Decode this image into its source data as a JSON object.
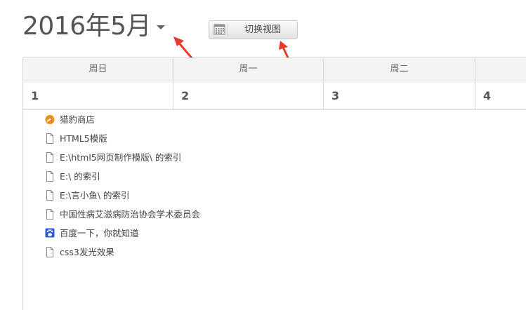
{
  "header": {
    "title": "2016年5月",
    "view_button_label": "切换视图",
    "view_button_icon": "calendar-grid-icon"
  },
  "calendar": {
    "weekdays": [
      "周日",
      "周一",
      "周二",
      ""
    ],
    "dates": [
      "1",
      "2",
      "3",
      "4"
    ]
  },
  "bookmarks": [
    {
      "label": "猎豹商店",
      "icon": "cheetah-store-icon"
    },
    {
      "label": "HTML5模版",
      "icon": "page-icon"
    },
    {
      "label": "E:\\html5网页制作模版\\ 的索引",
      "icon": "page-icon"
    },
    {
      "label": "E:\\ 的索引",
      "icon": "page-icon"
    },
    {
      "label": "E:\\言小鱼\\ 的索引",
      "icon": "page-icon"
    },
    {
      "label": "中国性病艾滋病防治协会学术委员会",
      "icon": "page-icon"
    },
    {
      "label": "百度一下，你就知道",
      "icon": "baidu-paw-icon"
    },
    {
      "label": "css3发光效果",
      "icon": "page-icon"
    }
  ],
  "colors": {
    "annotation_arrow": "#e8392b",
    "header_bg": "#f4f4f4",
    "grid_line": "#d6d6d6"
  }
}
